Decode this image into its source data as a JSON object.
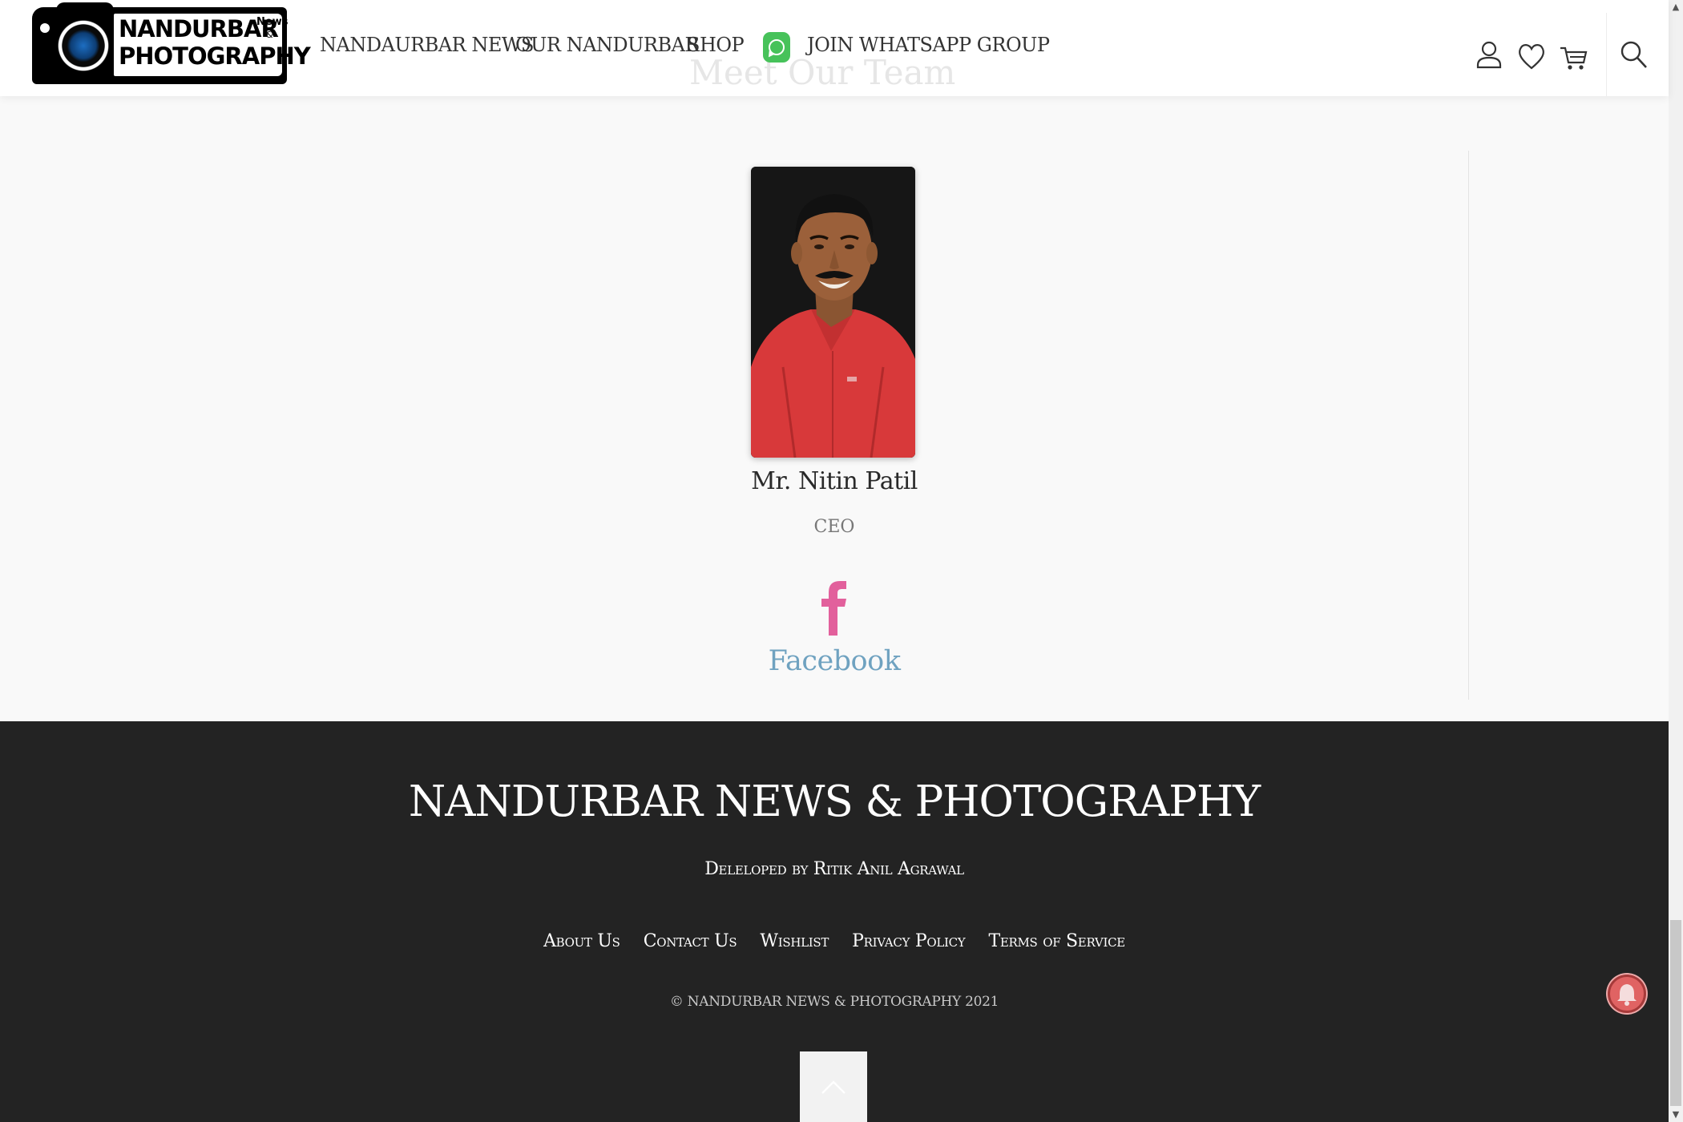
{
  "header": {
    "logo": {
      "line1": "NANDURBAR",
      "line2": "PHOTOGRAPHY",
      "tag_news": "News",
      "tag_amp": "&"
    },
    "nav": [
      {
        "label": "NANDAURBAR NEWS"
      },
      {
        "label": "OUR NANDURBAR"
      },
      {
        "label": "SHOP"
      },
      {
        "label": "JOIN WHATSAPP GROUP"
      }
    ],
    "icons": [
      "user-icon",
      "heart-icon",
      "cart-icon",
      "search-icon",
      "whatsapp-icon"
    ],
    "behind_heading": "Meet Our Team"
  },
  "team": {
    "member": {
      "name": "Mr. Nitin Patil",
      "role": "CEO",
      "social_label": "Facebook",
      "social_icon": "facebook-icon"
    }
  },
  "footer": {
    "title": "NANDURBAR NEWS & PHOTOGRAPHY",
    "developer": "Deleloped by Ritik Anil Agrawal",
    "links": [
      "About Us",
      "Contact Us",
      "Wishlist",
      "Privacy Policy",
      "Terms of Service"
    ],
    "copyright": "© NANDURBAR NEWS & PHOTOGRAPHY 2021",
    "back_to_top_icon": "chevron-up-icon",
    "notification_icon": "bell-icon"
  },
  "colors": {
    "facebook_icon": "#e2609c",
    "facebook_label": "#6fa2c0",
    "footer_bg": "#232323",
    "whatsapp": "#47c25a",
    "bell": "#e06363"
  }
}
